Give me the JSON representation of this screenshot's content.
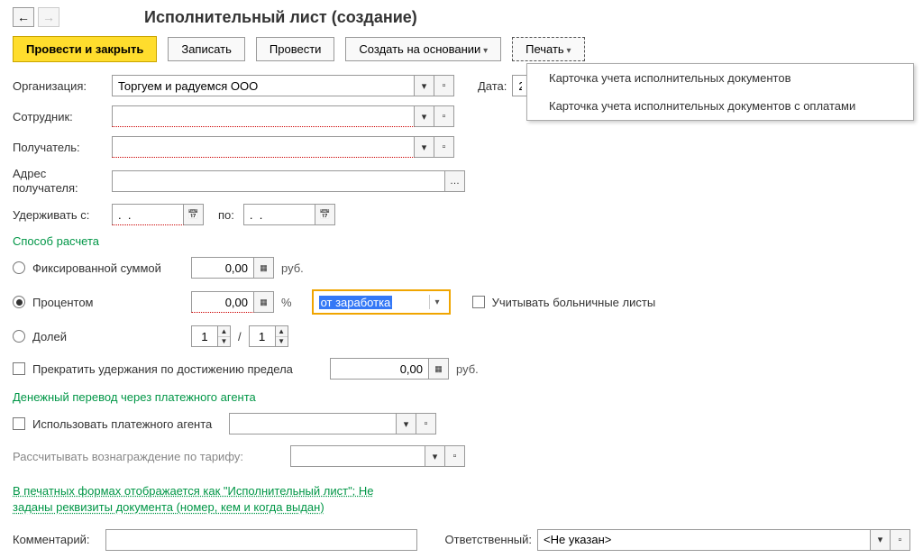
{
  "title": "Исполнительный лист (создание)",
  "nav": {
    "back": "←",
    "fwd": "→"
  },
  "toolbar": {
    "post_close": "Провести и закрыть",
    "save": "Записать",
    "post": "Провести",
    "create_based": "Создать на основании",
    "print": "Печать"
  },
  "print_menu": [
    "Карточка учета исполнительных документов",
    "Карточка учета исполнительных документов с оплатами"
  ],
  "fields": {
    "org_label": "Организация:",
    "org_value": "Торгуем и радуемся ООО",
    "date_label": "Дата:",
    "date_value": "2",
    "employee_label": "Сотрудник:",
    "employee_value": "",
    "recipient_label": "Получатель:",
    "recipient_value": "",
    "recipient_addr_label": "Адрес получателя:",
    "recipient_addr_value": "",
    "withhold_from_label": "Удерживать с:",
    "withhold_from_value": ".  .",
    "to_label": "по:",
    "withhold_to_value": ".  ."
  },
  "calc": {
    "header": "Способ расчета",
    "fixed_label": "Фиксированной суммой",
    "fixed_value": "0,00",
    "fixed_unit": "руб.",
    "percent_label": "Процентом",
    "percent_value": "0,00",
    "percent_unit": "%",
    "percent_base": "от заработка",
    "sick_label": "Учитывать больничные листы",
    "fraction_label": "Долей",
    "fraction_num": "1",
    "fraction_denom": "1",
    "stop_limit_label": "Прекратить удержания по достижению предела",
    "stop_limit_value": "0,00",
    "stop_limit_unit": "руб."
  },
  "agent": {
    "header": "Денежный перевод через платежного агента",
    "use_agent_label": "Использовать платежного агента",
    "agent_value": "",
    "tariff_label": "Рассчитывать вознаграждение по тарифу:",
    "tariff_value": ""
  },
  "link_text": "В печатных формах отображается как \"Исполнительный лист\"; Не заданы реквизиты документа (номер, кем и когда выдан)",
  "footer": {
    "comment_label": "Комментарий:",
    "comment_value": "",
    "resp_label": "Ответственный:",
    "resp_value": "<Не указан>"
  },
  "icons": {
    "dropdown": "▾",
    "open": "▫",
    "ellipsis": "…",
    "slash": "/"
  }
}
